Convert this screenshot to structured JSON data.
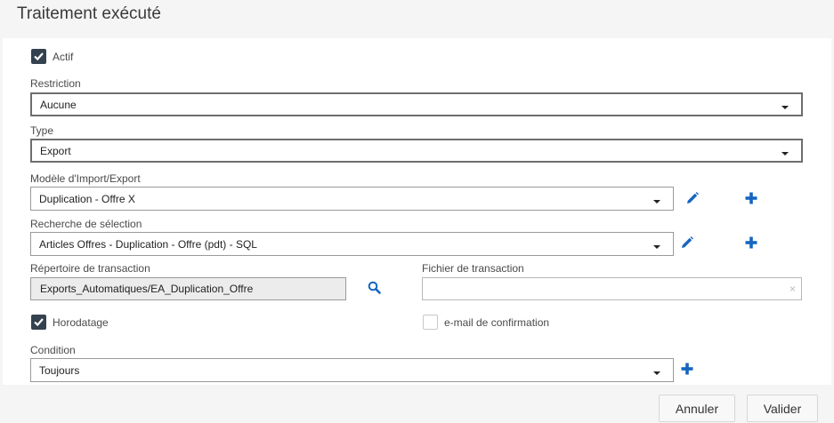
{
  "dialog": {
    "title": "Traitement exécuté"
  },
  "actif": {
    "label": "Actif",
    "checked": true
  },
  "restriction": {
    "label": "Restriction",
    "value": "Aucune"
  },
  "type": {
    "label": "Type",
    "value": "Export"
  },
  "modele": {
    "label": "Modèle d'Import/Export",
    "value": "Duplication - Offre X"
  },
  "recherche": {
    "label": "Recherche de sélection",
    "value": "Articles Offres - Duplication - Offre (pdt) - SQL"
  },
  "repertoire": {
    "label": "Répertoire de transaction",
    "value": "Exports_Automatiques/EA_Duplication_Offre"
  },
  "fichier": {
    "label": "Fichier de transaction",
    "value": "",
    "clear_glyph": "×"
  },
  "horodatage": {
    "label": "Horodatage",
    "checked": true
  },
  "email": {
    "label": "e-mail de confirmation",
    "checked": false
  },
  "condition": {
    "label": "Condition",
    "value": "Toujours"
  },
  "footer": {
    "cancel_label": "Annuler",
    "validate_label": "Valider"
  },
  "colors": {
    "accent": "#1565c0",
    "checkbox_checked": "#34414f"
  },
  "icons": {
    "edit": "pencil-icon",
    "add": "plus-icon",
    "search": "magnifier-icon",
    "dropdown": "caret-down-icon"
  }
}
